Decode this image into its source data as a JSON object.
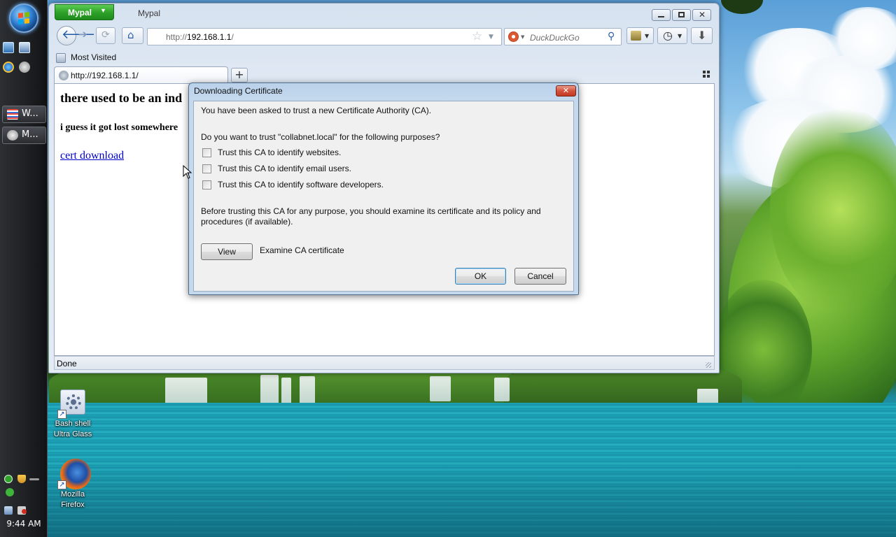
{
  "desktop": {
    "icons": [
      {
        "label_line1": "Bash shell",
        "label_line2": "Ultra Glass"
      },
      {
        "label_line1": "Mozilla",
        "label_line2": "Firefox"
      }
    ]
  },
  "taskbar": {
    "buttons": [
      {
        "label": "W..."
      },
      {
        "label": "M..."
      }
    ],
    "clock": "9:44 AM"
  },
  "browser": {
    "app_button_label": "Mypal",
    "window_title": "Mypal",
    "url": {
      "scheme": "http://",
      "host": "192.168.1.1",
      "rest": "/"
    },
    "search_placeholder": "DuckDuckGo",
    "bookmarks": {
      "most_visited": "Most Visited"
    },
    "tab": {
      "title": "http://192.168.1.1/"
    },
    "new_tab_symbol": "+",
    "page": {
      "heading": "there used to be an ind",
      "subheading": "i guess it got lost somewhere",
      "link": "cert download"
    },
    "status": "Done"
  },
  "dialog": {
    "title": "Downloading Certificate",
    "close_symbol": "✕",
    "intro": "You have been asked to trust a new Certificate Authority (CA).",
    "question": "Do you want to trust \"collabnet.local\" for the following purposes?",
    "options": [
      {
        "label": "Trust this CA to identify websites.",
        "checked": false
      },
      {
        "label": "Trust this CA to identify email users.",
        "checked": false
      },
      {
        "label": "Trust this CA to identify software developers.",
        "checked": false
      }
    ],
    "advice_line1": "Before trusting this CA for any purpose, you should examine its certificate and its policy and",
    "advice_line2": "procedures (if available).",
    "view_button": "View",
    "view_caption": "Examine CA certificate",
    "ok_button": "OK",
    "cancel_button": "Cancel"
  },
  "colors": {
    "app_button": "#2fa32a",
    "link": "#0000cc",
    "dialog_frame": "#c5d9ee",
    "close_button": "#c13b22"
  }
}
